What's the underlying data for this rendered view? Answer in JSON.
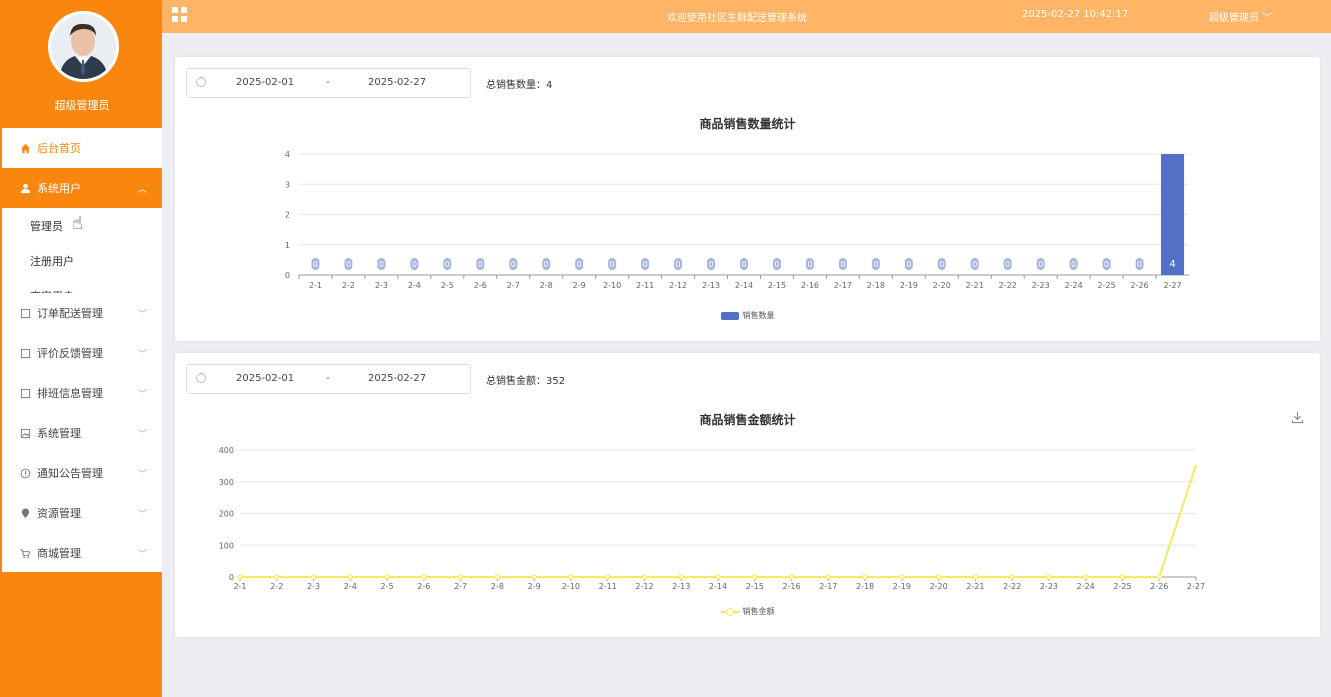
{
  "sidebar": {
    "profile_name": "超级管理员",
    "menu": [
      {
        "label": "后台首页",
        "icon": "home-icon"
      },
      {
        "label": "系统用户",
        "icon": "user-icon"
      },
      {
        "label": "订单配送管理",
        "icon": "file-icon"
      },
      {
        "label": "评价反馈管理",
        "icon": "file-icon"
      },
      {
        "label": "排班信息管理",
        "icon": "file-icon"
      },
      {
        "label": "系统管理",
        "icon": "image-icon"
      },
      {
        "label": "通知公告管理",
        "icon": "info-icon"
      },
      {
        "label": "资源管理",
        "icon": "location-icon"
      },
      {
        "label": "商城管理",
        "icon": "cart-icon"
      }
    ],
    "submenu": [
      "管理员",
      "注册用户",
      "商家用户"
    ]
  },
  "header": {
    "welcome": "欢迎使用社区生鲜配送管理系统",
    "datetime": "2025-02-27 10:42:17",
    "user": "超级管理员"
  },
  "card1": {
    "date_start": "2025-02-01",
    "date_sep": "-",
    "date_end": "2025-02-27",
    "total": "总销售数量：4",
    "title": "商品销售数量统计",
    "legend": "销售数量"
  },
  "card2": {
    "date_start": "2025-02-01",
    "date_sep": "-",
    "date_end": "2025-02-27",
    "total": "总销售金额：352",
    "title": "商品销售金额统计",
    "legend": "销售金额"
  },
  "chart_data": [
    {
      "type": "bar",
      "title": "商品销售数量统计",
      "categories": [
        "2-1",
        "2-2",
        "2-3",
        "2-4",
        "2-5",
        "2-6",
        "2-7",
        "2-8",
        "2-9",
        "2-10",
        "2-11",
        "2-12",
        "2-13",
        "2-14",
        "2-15",
        "2-16",
        "2-17",
        "2-18",
        "2-19",
        "2-20",
        "2-21",
        "2-22",
        "2-23",
        "2-24",
        "2-25",
        "2-26",
        "2-27"
      ],
      "series": [
        {
          "name": "销售数量",
          "values": [
            0,
            0,
            0,
            0,
            0,
            0,
            0,
            0,
            0,
            0,
            0,
            0,
            0,
            0,
            0,
            0,
            0,
            0,
            0,
            0,
            0,
            0,
            0,
            0,
            0,
            0,
            4
          ]
        }
      ],
      "ylim": [
        0,
        4
      ],
      "yticks": [
        0,
        1,
        2,
        3,
        4
      ],
      "color": "#5470c6",
      "legend": "bottom-center",
      "grid": true
    },
    {
      "type": "line",
      "title": "商品销售金额统计",
      "categories": [
        "2-1",
        "2-2",
        "2-3",
        "2-4",
        "2-5",
        "2-6",
        "2-7",
        "2-8",
        "2-9",
        "2-10",
        "2-11",
        "2-12",
        "2-13",
        "2-14",
        "2-15",
        "2-16",
        "2-17",
        "2-18",
        "2-19",
        "2-20",
        "2-21",
        "2-22",
        "2-23",
        "2-24",
        "2-25",
        "2-26",
        "2-27"
      ],
      "series": [
        {
          "name": "销售金额",
          "values": [
            0,
            0,
            0,
            0,
            0,
            0,
            0,
            0,
            0,
            0,
            0,
            0,
            0,
            0,
            0,
            0,
            0,
            0,
            0,
            0,
            0,
            0,
            0,
            0,
            0,
            0,
            352
          ]
        }
      ],
      "ylim": [
        0,
        400
      ],
      "yticks": [
        0,
        100,
        200,
        300,
        400
      ],
      "color": "#f6ea5e",
      "legend": "bottom-center",
      "grid": true
    }
  ]
}
